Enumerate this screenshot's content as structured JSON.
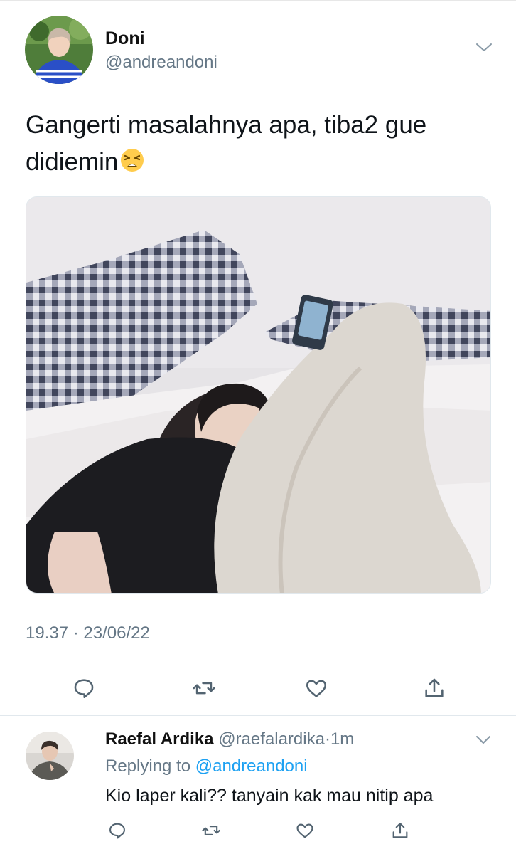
{
  "tweet": {
    "author_name": "Doni",
    "author_handle": "@andreandoni",
    "text": "Gangerti masalahnya apa, tiba2 gue didiemin",
    "emoji": "weary-face-emoji",
    "timestamp": "19.37 · 23/06/22",
    "actions": [
      "reply-icon",
      "retweet-icon",
      "like-icon",
      "share-icon"
    ]
  },
  "reply": {
    "author_name": "Raefal Ardika",
    "author_handle": "@raefalardika",
    "separator": "·",
    "time": "1m",
    "replying_prefix": "Replying to",
    "replying_handle": "@andreandoni",
    "text": "Kio laper kali?? tanyain kak mau nitip apa",
    "actions": [
      "reply-icon",
      "retweet-icon",
      "like-icon",
      "share-icon"
    ]
  },
  "colors": {
    "link": "#1da1f2",
    "secondary_text": "#657786",
    "icon": "#536471",
    "divider": "#e1e8ed"
  }
}
